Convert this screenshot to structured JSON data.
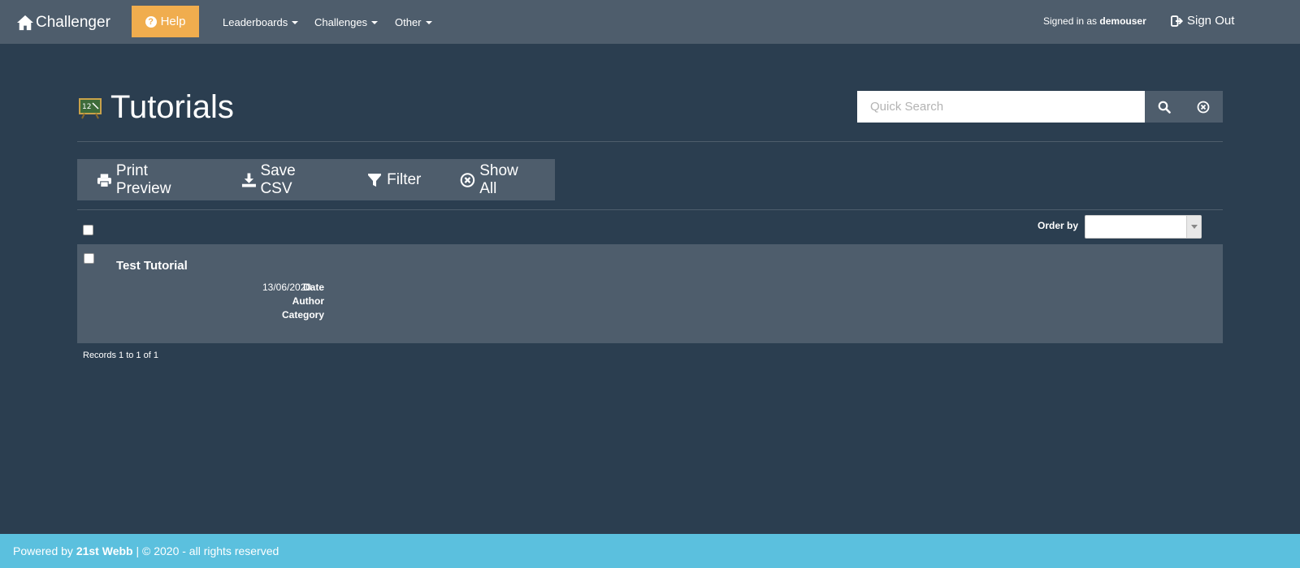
{
  "nav": {
    "brand": "Challenger",
    "help_label": "Help",
    "menus": [
      {
        "label": "Leaderboards"
      },
      {
        "label": "Challenges"
      },
      {
        "label": "Other"
      }
    ],
    "signed_in_prefix": "Signed in as",
    "username": "demouser",
    "signout_label": "Sign Out"
  },
  "page": {
    "title": "Tutorials",
    "board_icon_text": "12"
  },
  "search": {
    "placeholder": "Quick Search"
  },
  "toolbar": {
    "print_label": "Print Preview",
    "csv_label": "Save CSV",
    "filter_label": "Filter",
    "showall_label": "Show All"
  },
  "order": {
    "label": "Order by",
    "selected": ""
  },
  "records": [
    {
      "title": "Test Tutorial",
      "date_label": "Date",
      "date": "13/06/2020",
      "author_label": "Author",
      "author": "",
      "category_label": "Category",
      "category": ""
    }
  ],
  "records_info": "Records 1 to 1 of 1",
  "footer": {
    "powered_by": "Powered by",
    "company": "21st Webb",
    "copyright": "| © 2020 - all rights reserved"
  },
  "colors": {
    "background": "#2b3e50",
    "navbar": "#4e5d6c",
    "help": "#f0ad4e",
    "footer": "#5bc0de"
  }
}
